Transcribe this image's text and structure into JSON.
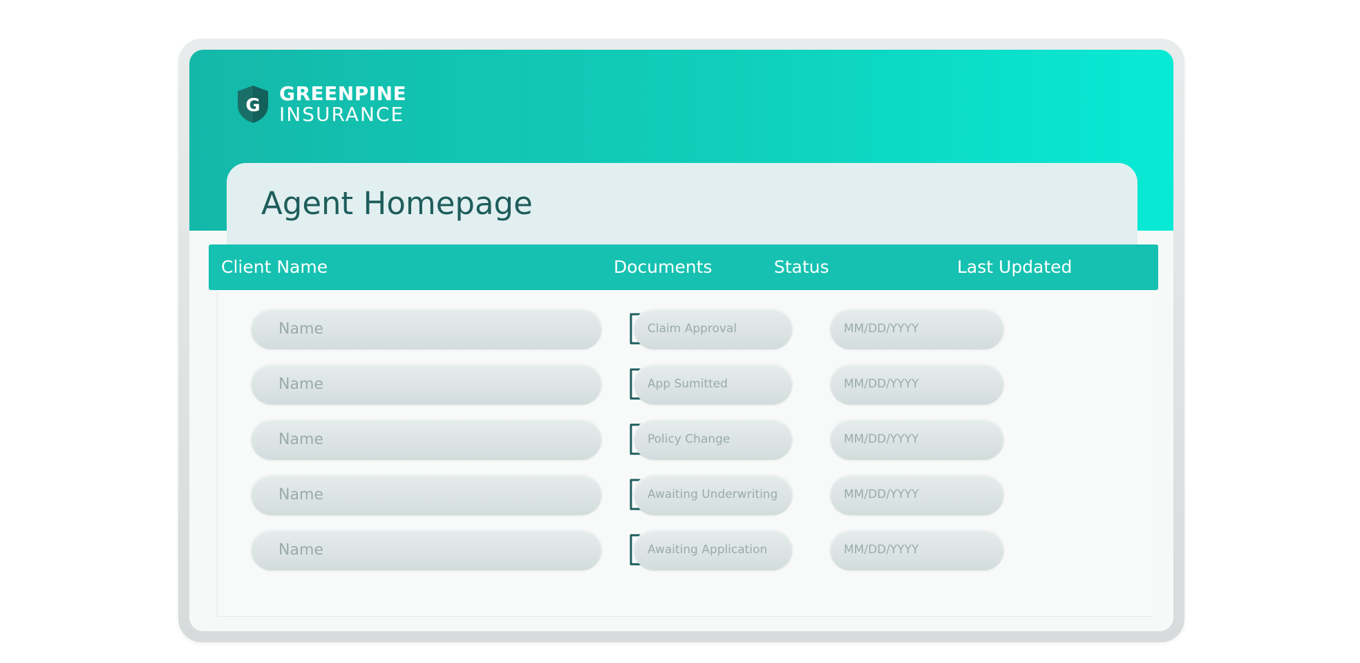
{
  "brand": {
    "logo_letter": "G",
    "name_line1": "GREENPINE",
    "name_line2": "INSURANCE"
  },
  "page": {
    "title": "Agent Homepage"
  },
  "table": {
    "columns": {
      "client_name": "Client Name",
      "documents": "Documents",
      "status": "Status",
      "last_updated": "Last Updated"
    },
    "rows": [
      {
        "name": "Name",
        "status": "Claim Approval",
        "date": "MM/DD/YYYY"
      },
      {
        "name": "Name",
        "status": "App Sumitted",
        "date": "MM/DD/YYYY"
      },
      {
        "name": "Name",
        "status": "Policy Change",
        "date": "MM/DD/YYYY"
      },
      {
        "name": "Name",
        "status": "Awaiting Underwriting",
        "date": "MM/DD/YYYY"
      },
      {
        "name": "Name",
        "status": "Awaiting Application",
        "date": "MM/DD/YYYY"
      }
    ]
  },
  "icons": {
    "document": "document-icon",
    "download": "download-icon"
  },
  "colors": {
    "primary_teal": "#16c1b1",
    "hero_gradient_end": "#07ead5",
    "title_text": "#1e5d5c",
    "icon_teal": "#1e5d5c",
    "placeholder_text": "#9aabab"
  }
}
